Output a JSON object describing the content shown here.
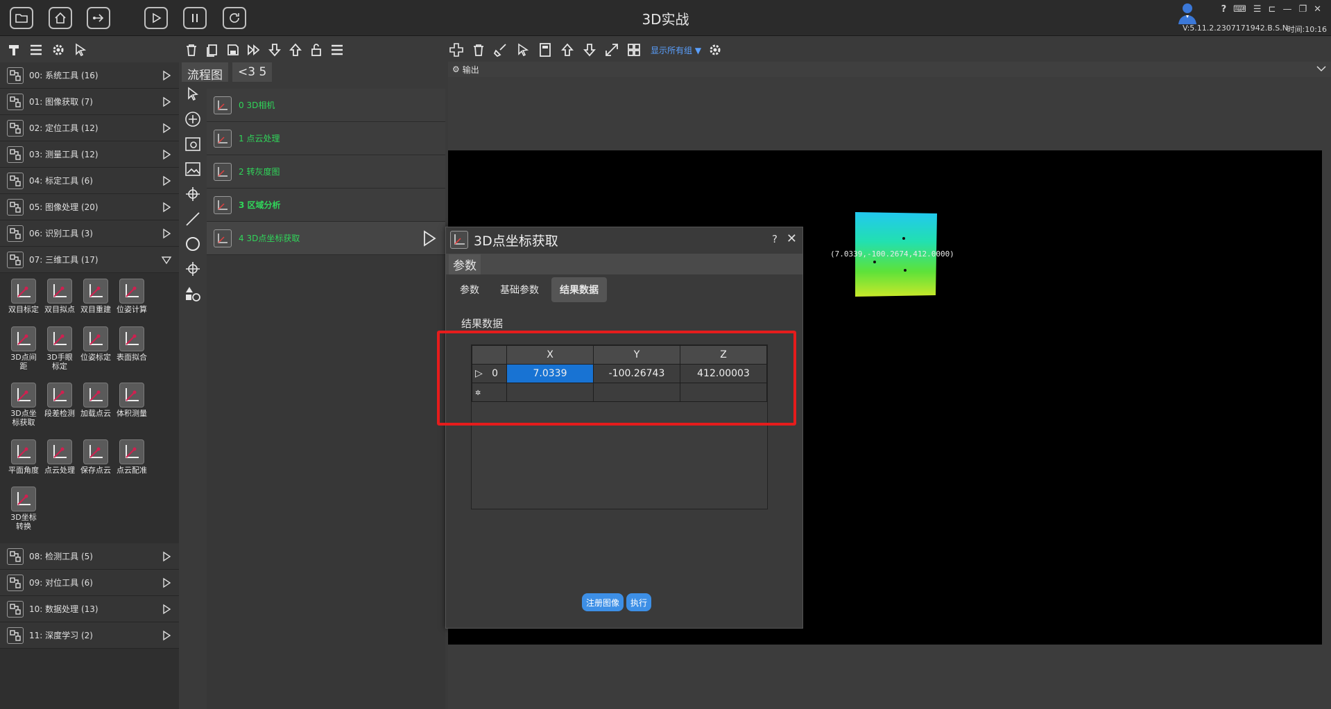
{
  "app": {
    "title": "3D实战",
    "version": "V:5.11.2.2307171942.B.S.N",
    "time": "时间:10:16",
    "help": "?"
  },
  "left_panel": {
    "categories_top": [
      {
        "label": "00: 系统工具 (16)",
        "icon": "system-tools-icon"
      },
      {
        "label": "01: 图像获取 (7)",
        "icon": "image-acquire-icon"
      },
      {
        "label": "02: 定位工具 (12)",
        "icon": "locate-tools-icon"
      },
      {
        "label": "03: 测量工具 (12)",
        "icon": "measure-tools-icon"
      },
      {
        "label": "04: 标定工具 (6)",
        "icon": "calibration-tools-icon"
      },
      {
        "label": "05: 图像处理 (20)",
        "icon": "image-processing-icon"
      },
      {
        "label": "06: 识别工具 (3)",
        "icon": "recognition-tools-icon"
      },
      {
        "label": "07: 三维工具 (17)",
        "icon": "3d-tools-icon"
      }
    ],
    "tools": [
      {
        "label": "双目标定"
      },
      {
        "label": "双目拟点"
      },
      {
        "label": "双目重建"
      },
      {
        "label": "位姿计算"
      },
      {
        "label": "3D点间距"
      },
      {
        "label": "3D手眼标定"
      },
      {
        "label": "位姿标定"
      },
      {
        "label": "表面拟合"
      },
      {
        "label": "3D点坐标获取"
      },
      {
        "label": "段差检测"
      },
      {
        "label": "加载点云"
      },
      {
        "label": "体积测量"
      },
      {
        "label": "平面角度"
      },
      {
        "label": "点云处理"
      },
      {
        "label": "保存点云"
      },
      {
        "label": "点云配准"
      },
      {
        "label": "3D坐标转换"
      }
    ],
    "categories_bottom": [
      {
        "label": "08: 检测工具 (5)",
        "icon": "detect-tools-icon"
      },
      {
        "label": "09: 对位工具 (6)",
        "icon": "align-tools-icon"
      },
      {
        "label": "10: 数据处理 (13)",
        "icon": "data-processing-icon"
      },
      {
        "label": "11: 深度学习 (2)",
        "icon": "deep-learning-icon"
      }
    ]
  },
  "flow": {
    "tab_label": "流程图",
    "nav_label": "<3 5",
    "items": [
      {
        "label": "0 3D相机"
      },
      {
        "label": "1 点云处理"
      },
      {
        "label": "2 转灰度图"
      },
      {
        "label": "3 区域分析"
      },
      {
        "label": "4 3D点坐标获取"
      }
    ]
  },
  "right_toolbar": {
    "show_all_label": "显示所有组"
  },
  "output": {
    "label": "输出",
    "coord_text": "(7.0339,-100.2674,412.0000)"
  },
  "dialog": {
    "title": "3D点坐标获取",
    "help": "?",
    "close": "✕",
    "section_label": "参数",
    "tabs": [
      "参数",
      "基础参数",
      "结果数据"
    ],
    "active_tab": "结果数据",
    "result_title": "结果数据",
    "table": {
      "columns": [
        "X",
        "Y",
        "Z"
      ],
      "rows": [
        {
          "index": "0",
          "values": [
            "7.0339",
            "-100.26743",
            "412.00003"
          ]
        }
      ]
    },
    "buttons": {
      "register_image": "注册图像",
      "execute": "执行"
    }
  },
  "colors": {
    "accent": "#1873d3",
    "flow_text": "#30d65a",
    "highlight_box": "#e51c1c",
    "button_bg": "#3d8fe6"
  }
}
